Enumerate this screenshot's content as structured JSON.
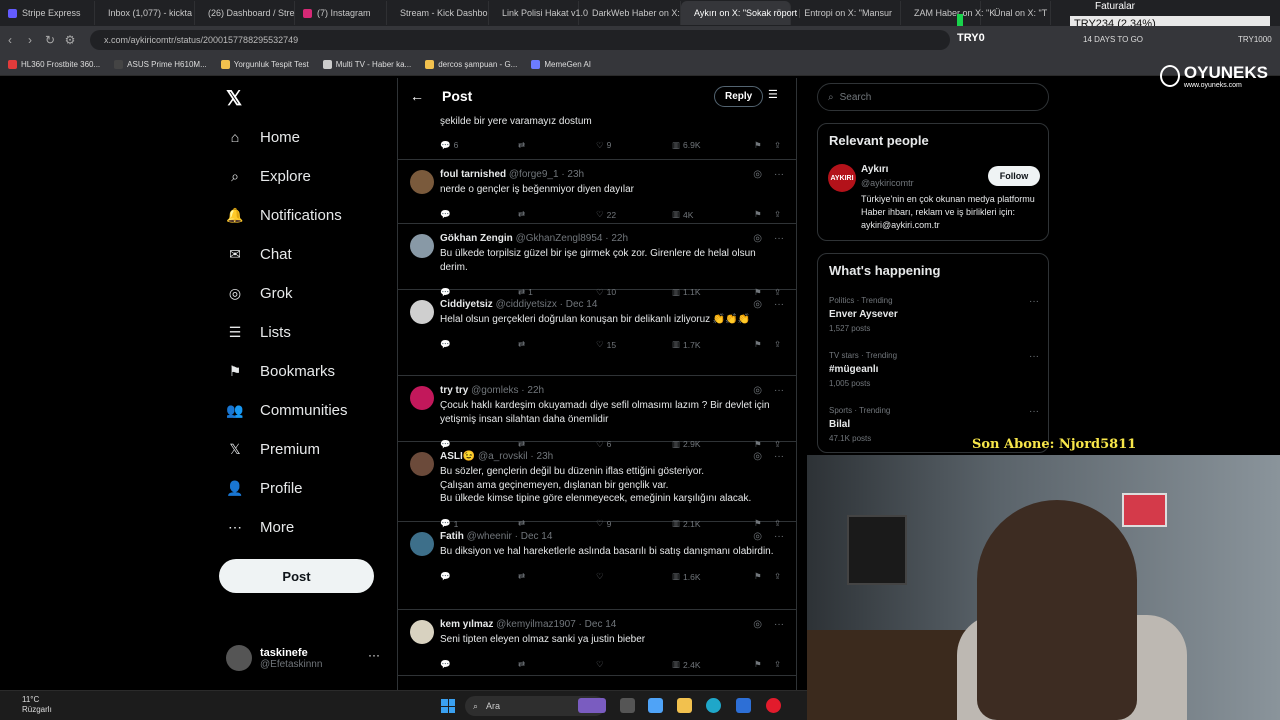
{
  "browser": {
    "tabs": [
      {
        "label": "Stripe Express",
        "color": "#635bff"
      },
      {
        "label": "Inbox (1,077) - kickta",
        "color": "#d93025"
      },
      {
        "label": "(26) Dashboard / Stre",
        "color": "#2f8f4f"
      },
      {
        "label": "(7) Instagram",
        "color": "#d62976"
      },
      {
        "label": "Stream - Kick Dashbo",
        "color": "#53fc18"
      },
      {
        "label": "Link Polisi Hakat v1.0",
        "color": "#8b5cf6"
      },
      {
        "label": "DarkWeb Haber on X:",
        "color": "#444444"
      },
      {
        "label": "Aykırı on X: \"Sokak röport",
        "color": "#444444"
      },
      {
        "label": "Entropi on X: \"Mansur",
        "color": "#444444"
      },
      {
        "label": "ZAM Haber on X: \"K",
        "color": "#444444"
      },
      {
        "label": "Ünal on X: \"T",
        "color": "#444444"
      }
    ],
    "url": "x.com/aykiricomtr/status/2000157788295532749",
    "bookmarks": [
      {
        "label": "HL360 Frostbite 360...",
        "color": "#e23b3b"
      },
      {
        "label": "ASUS Prime H610M...",
        "color": "#444444"
      },
      {
        "label": "Yorgunluk Tespit Test",
        "color": "#f2c14e"
      },
      {
        "label": "Multi TV - Haber ka...",
        "color": "#cccccc"
      },
      {
        "label": "dercos şampuan - G...",
        "color": "#f2c14e"
      },
      {
        "label": "MemeGen AI",
        "color": "#6c7cff"
      }
    ]
  },
  "overlay": {
    "faturalar": "Faturalar",
    "ticker": "TRY234 (2.34%)",
    "ticker_sub": "TRY0",
    "days_to_go": "14 DAYS TO GO",
    "goal_right": "TRY1000",
    "brand": "OYUNEKS",
    "brand_url": "www.oyuneks.com",
    "last_sub": "Son Abone: Njord5811"
  },
  "nav": {
    "items": [
      {
        "key": "home",
        "label": "Home"
      },
      {
        "key": "explore",
        "label": "Explore"
      },
      {
        "key": "notifications",
        "label": "Notifications"
      },
      {
        "key": "chat",
        "label": "Chat"
      },
      {
        "key": "grok",
        "label": "Grok"
      },
      {
        "key": "lists",
        "label": "Lists"
      },
      {
        "key": "bookmarks",
        "label": "Bookmarks"
      },
      {
        "key": "communities",
        "label": "Communities"
      },
      {
        "key": "premium",
        "label": "Premium"
      },
      {
        "key": "profile",
        "label": "Profile"
      },
      {
        "key": "more",
        "label": "More"
      }
    ],
    "post_label": "Post",
    "account": {
      "name": "taskinefe",
      "handle": "@Efetaskinnn"
    }
  },
  "feed": {
    "title": "Post",
    "reply_label": "Reply",
    "partial_text": "şekilde bir yere varamayız dostum",
    "partial_stats": {
      "replies": "6",
      "retweets": "",
      "likes": "9",
      "views": "6.9K"
    },
    "tweets": [
      {
        "name": "foul tarnished",
        "handle": "@forge9_1 · 23h",
        "text": "nerde o gençler iş beğenmiyor diyen dayılar",
        "replies": "",
        "retweets": "",
        "likes": "22",
        "views": "4K",
        "avatar_color": "#7a5a3c"
      },
      {
        "name": "Gökhan Zengin",
        "handle": "@GkhanZengl8954 · 22h",
        "text": "Bu ülkede torpilsiz güzel bir işe girmek çok zor. Girenlere de helal olsun derim.",
        "replies": "",
        "retweets": "1",
        "likes": "10",
        "views": "1.1K",
        "avatar_color": "#8899a6"
      },
      {
        "name": "Ciddiyetsiz",
        "handle": "@ciddiyetsizx · Dec 14",
        "text": "Helal olsun gerçekleri doğrulan konuşan bir delikanlı izliyoruz 👏👏👏",
        "replies": "",
        "retweets": "",
        "likes": "15",
        "views": "1.7K",
        "avatar_color": "#cfcfcf"
      },
      {
        "name": "try try",
        "handle": "@gomleks · 22h",
        "text": "Çocuk haklı kardeşim okuyamadı diye sefil olmasımı lazım ? Bir devlet için yetişmiş insan silahtan daha önemlidir",
        "replies": "",
        "retweets": "",
        "likes": "6",
        "views": "2.9K",
        "avatar_color": "#c2185b"
      },
      {
        "name": "ASLI😉",
        "handle": "@a_rovskil · 23h",
        "text": "Bu sözler, gençlerin değil bu düzenin iflas ettiğini gösteriyor.\nÇalışan ama geçinemeyen, dışlanan bir gençlik var.\nBu ülkede kimse tipine göre elenmeyecek, emeğinin karşılığını alacak.",
        "replies": "1",
        "retweets": "",
        "likes": "9",
        "views": "2.1K",
        "avatar_color": "#6b4a3a"
      },
      {
        "name": "Fatih",
        "handle": "@wheenir · Dec 14",
        "text": "Bu diksiyon ve hal hareketlerle aslında basarılı bi satış danışmanı olabirdin.",
        "replies": "",
        "retweets": "",
        "likes": "",
        "views": "1.6K",
        "avatar_color": "#3d6f8a"
      },
      {
        "name": "kem yılmaz",
        "handle": "@kemyilmaz1907 · Dec 14",
        "text": "Seni tipten eleyen olmaz sanki ya justin bieber",
        "replies": "",
        "retweets": "",
        "likes": "",
        "views": "2.4K",
        "avatar_color": "#d8d2c0"
      }
    ]
  },
  "right": {
    "search_placeholder": "Search",
    "relevant_title": "Relevant people",
    "person": {
      "name": "Aykırı",
      "handle": "@aykiricomtr",
      "bio": "Türkiye'nin en çok okunan medya platformu Haber ihbarı, reklam ve iş birlikleri için: aykiri@aykiri.com.tr",
      "logo_text": "AYKIRI",
      "follow_label": "Follow"
    },
    "happening_title": "What's happening",
    "trends": [
      {
        "category": "Politics · Trending",
        "name": "Enver Aysever",
        "count": "1,527 posts"
      },
      {
        "category": "TV stars · Trending",
        "name": "#mügeanlı",
        "count": "1,005 posts"
      },
      {
        "category": "Sports · Trending",
        "name": "Bilal",
        "count": "47.1K posts"
      }
    ]
  },
  "taskbar": {
    "temp": "11°C",
    "weather": "Rüzgarlı",
    "search_label": "Ara"
  }
}
